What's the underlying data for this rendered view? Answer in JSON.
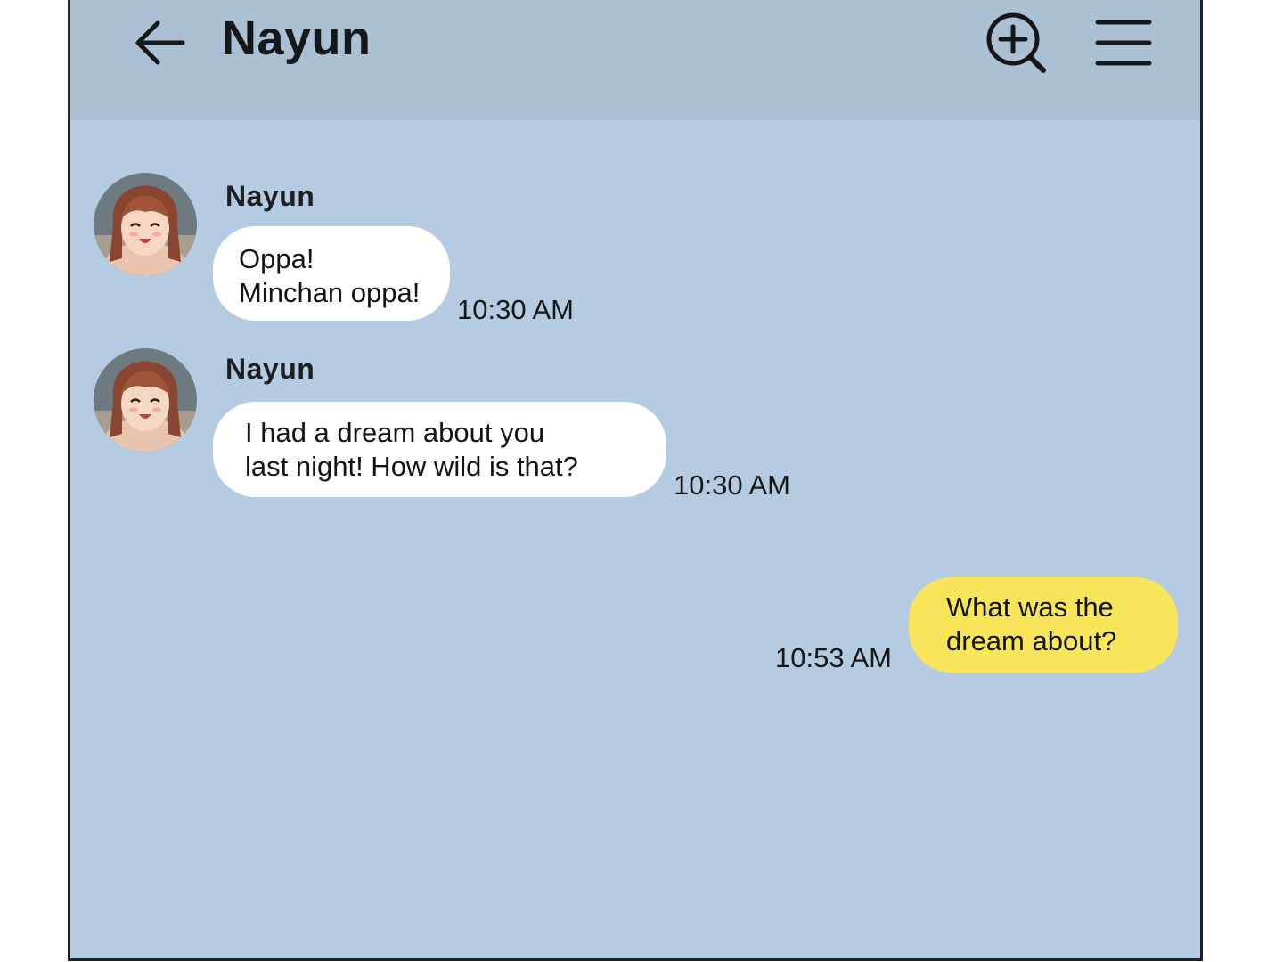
{
  "header": {
    "back_icon": "arrow-left-icon",
    "title": "Nayun",
    "search_icon": "zoom-in-icon",
    "menu_icon": "hamburger-menu-icon"
  },
  "colors": {
    "background": "#b5cbe1",
    "header": "#acc0d3",
    "incoming_bubble": "#ffffff",
    "outgoing_bubble": "#f9e559"
  },
  "messages": [
    {
      "sender": "Nayun",
      "lines": [
        "Oppa!",
        "Minchan oppa!"
      ],
      "time": "10:30 AM"
    },
    {
      "sender": "Nayun",
      "lines": [
        "I had a dream about you",
        "last night! How wild is that?"
      ],
      "time": "10:30 AM"
    },
    {
      "sender": "",
      "lines": [
        "What was the",
        "dream about?"
      ],
      "time": "10:53 AM"
    }
  ]
}
